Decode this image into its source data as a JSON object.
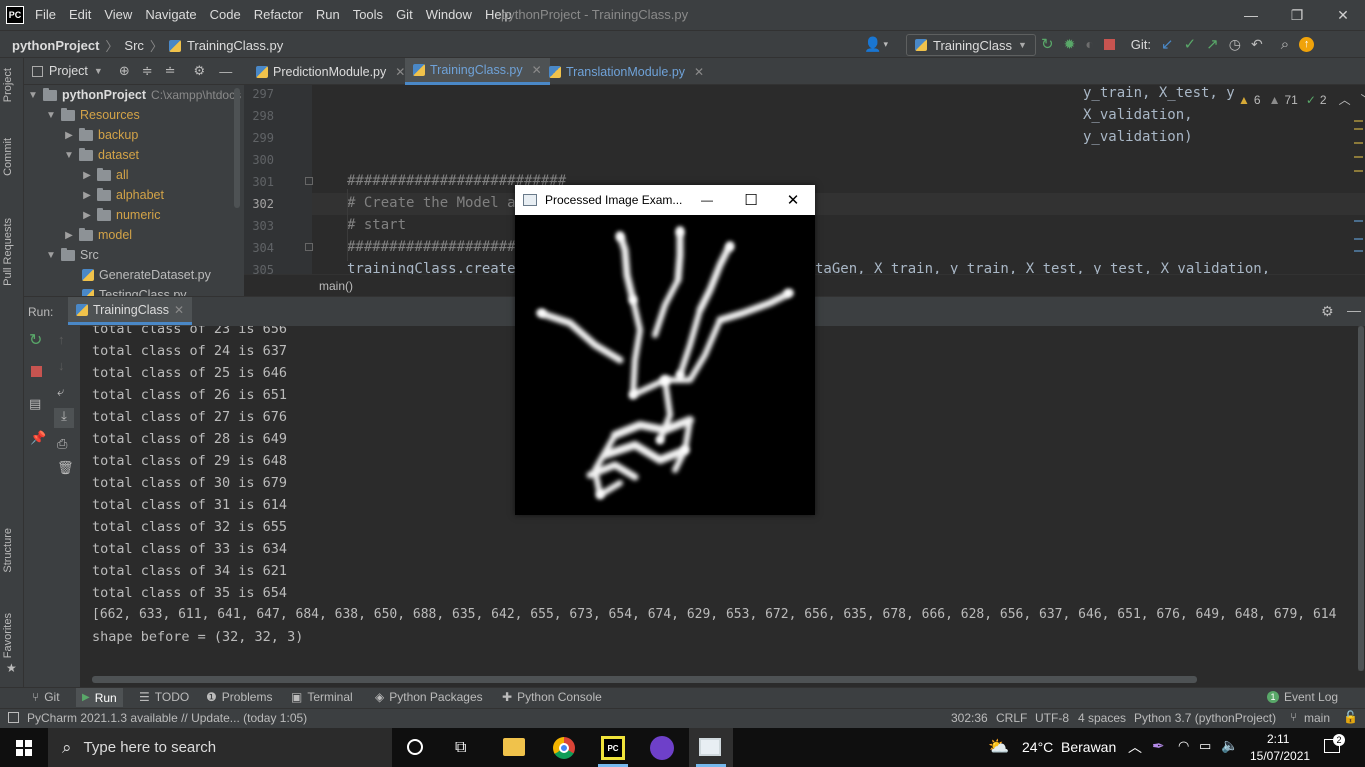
{
  "app": {
    "logo_text": "PC",
    "menu": [
      "File",
      "Edit",
      "View",
      "Navigate",
      "Code",
      "Refactor",
      "Run",
      "Tools",
      "Git",
      "Window",
      "Help"
    ],
    "window_title": "pythonProject - TrainingClass.py"
  },
  "navbar": {
    "breadcrumb_project": "pythonProject",
    "breadcrumb_folder": "Src",
    "breadcrumb_file": "TrainingClass.py",
    "run_config": "TrainingClass",
    "git_label": "Git:"
  },
  "sidebar_tabs": {
    "project": "Project",
    "commit": "Commit",
    "pull_requests": "Pull Requests",
    "structure": "Structure",
    "favorites": "Favorites"
  },
  "project_panel": {
    "title": "Project",
    "tree": [
      {
        "label": "pythonProject",
        "extra": "C:\\xampp\\htdocs",
        "bold": true
      },
      {
        "label": "Resources"
      },
      {
        "label": "backup"
      },
      {
        "label": "dataset"
      },
      {
        "label": "all"
      },
      {
        "label": "alphabet"
      },
      {
        "label": "numeric"
      },
      {
        "label": "model"
      },
      {
        "label": "Src"
      },
      {
        "label": "GenerateDataset.py"
      },
      {
        "label": "TestingClass.py"
      }
    ]
  },
  "editor": {
    "tabs": [
      "PredictionModule.py",
      "TrainingClass.py",
      "TranslationModule.py"
    ],
    "inspections": {
      "warnings": "6",
      "weak_warnings": "71",
      "typos": "2"
    },
    "lines": [
      {
        "num": "297",
        "text": "y_train, X_test, y"
      },
      {
        "num": "298",
        "text": "X_validation,"
      },
      {
        "num": "299",
        "text": "y_validation)"
      },
      {
        "num": "300",
        "text": ""
      },
      {
        "num": "301",
        "text": "##########################"
      },
      {
        "num": "302",
        "text": "# Create the Model an"
      },
      {
        "num": "303",
        "text": "# start"
      },
      {
        "num": "304",
        "text": "#######################"
      },
      {
        "num": "305",
        "text": "trainingClass.createM"
      },
      {
        "num": "",
        "text": "taGen, X_train, y_train, X_test, y_test, X_validation,"
      }
    ],
    "breadcrumb": "main()"
  },
  "run_panel": {
    "label": "Run:",
    "tab": "TrainingClass",
    "output": [
      "total class of 23 is 656",
      "total class of 24 is 637",
      "total class of 25 is 646",
      "total class of 26 is 651",
      "total class of 27 is 676",
      "total class of 28 is 649",
      "total class of 29 is 648",
      "total class of 30 is 679",
      "total class of 31 is 614",
      "total class of 32 is 655",
      "total class of 33 is 634",
      "total class of 34 is 621",
      "total class of 35 is 654",
      "[662, 633, 611, 641, 647, 684, 638, 650, 688, 635, 642, 655, 673, 654, 674, 629, 653, 672, 656, 635, 678, 666, 628, 656, 637, 646, 651, 676, 649, 648, 679, 614",
      "shape before = (32, 32, 3)"
    ]
  },
  "popup": {
    "title": "Processed Image Exam...",
    "minimize": "—",
    "maximize": "☐",
    "close": "✕"
  },
  "bottom_tools": [
    "Git",
    "Run",
    "TODO",
    "Problems",
    "Terminal",
    "Python Packages",
    "Python Console"
  ],
  "event_log": "Event Log",
  "status": {
    "message": "PyCharm 2021.1.3 available // Update... (today 1:05)",
    "position": "302:36",
    "line_sep": "CRLF",
    "encoding": "UTF-8",
    "indent": "4 spaces",
    "interpreter": "Python 3.7 (pythonProject)",
    "branch": "main"
  },
  "taskbar": {
    "search_placeholder": "Type here to search",
    "weather_temp": "24°C",
    "weather_text": "Berawan",
    "time": "2:11",
    "date": "15/07/2021",
    "pycharm_icon_text": "PC"
  }
}
